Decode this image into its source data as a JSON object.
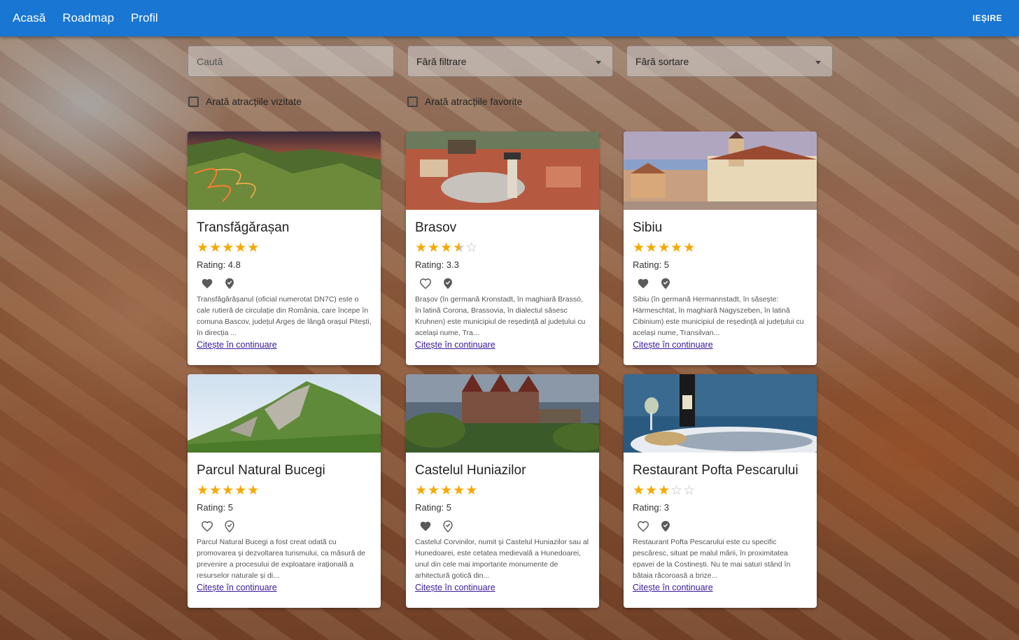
{
  "nav": {
    "home": "Acasă",
    "roadmap": "Roadmap",
    "profile": "Profil",
    "logout": "IEȘIRE"
  },
  "filters": {
    "search_placeholder": "Caută",
    "filter_value": "Fără filtrare",
    "sort_value": "Fără sortare",
    "visited_label": "Arată atracțiile vizitate",
    "favorites_label": "Arată atracțiile favorite"
  },
  "read_more": "Citește în continuare",
  "attractions": [
    {
      "title": "Transfăgărașan",
      "stars": 4.8,
      "rating": "Rating: 4.8",
      "favorite": true,
      "visited": true,
      "description": "Transfăgărășanul (oficial numerotat DN7C) este o cale rutieră de circulație din România, care începe în comuna Bascov, județul Argeș de lângă orașul Pitești, în direcția ...",
      "link": "Citește în continuare"
    },
    {
      "title": "Brasov",
      "stars": 3.3,
      "rating": "Rating: 3.3",
      "favorite": false,
      "visited": true,
      "description": "Brașov (în germană Kronstadt, în maghiară Brassó, în latină Corona, Brassovia, în dialectul săsesc Kruhnen) este municipiul de reședință al județului cu același nume, Tra...",
      "link": "Citește în continuare"
    },
    {
      "title": "Sibiu",
      "stars": 5,
      "rating": "Rating: 5",
      "favorite": true,
      "visited": true,
      "description": "Sibiu (în germană Hermannstadt, în săsește: Härmeschtat, în maghiară Nagyszeben, în latină Cibinium) este municipiul de reședință al județului cu același nume, Transilvan...",
      "link": "Citește în continuare"
    },
    {
      "title": "Parcul Natural Bucegi",
      "stars": 5,
      "rating": "Rating: 5",
      "favorite": false,
      "visited": false,
      "description": "Parcul Natural Bucegi a fost creat odată cu promovarea și dezvoltarea turismului, ca măsură de prevenire a procesului de exploatare irațională a resurselor naturale și di...",
      "link": "Citește în continuare"
    },
    {
      "title": "Castelul Huniazilor",
      "stars": 5,
      "rating": "Rating: 5",
      "favorite": true,
      "visited": false,
      "description": "Castelul Corvinilor, numit și Castelul Huniazilor sau al Hunedoarei, este cetatea medievală a Hunedoarei, unul din cele mai importante monumente de arhitectură gotică din...",
      "link": "Citește în continuare"
    },
    {
      "title": "Restaurant Pofta Pescarului",
      "stars": 3,
      "rating": "Rating: 3",
      "favorite": false,
      "visited": true,
      "description": "Restaurant Pofta Pescarului este cu specific pescăresc, situat pe malul mării, în proximitatea epavei de la Costinești. Nu te mai saturi stând în bătaia răcoroasă a brize...",
      "link": "Citește în continuare"
    }
  ]
}
